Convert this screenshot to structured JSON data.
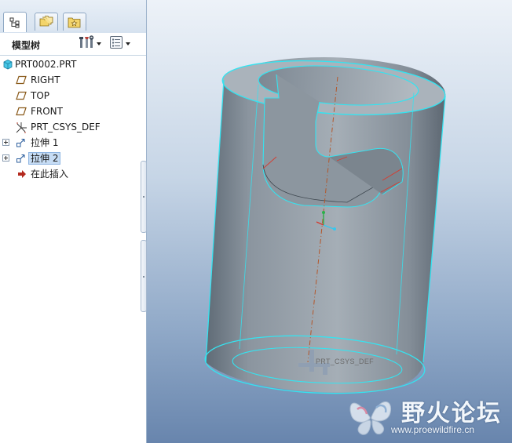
{
  "tabs": [
    {
      "icon": "model-tree-icon",
      "active": true
    },
    {
      "icon": "folder-browser-icon",
      "active": false
    },
    {
      "icon": "favorites-icon",
      "active": false
    }
  ],
  "panel": {
    "title": "模型树",
    "settings_icon": "tree-settings-icon",
    "show_icon": "tree-show-icon"
  },
  "tree": {
    "root": {
      "label": "PRT0002.PRT",
      "icon": "part-icon"
    },
    "items": [
      {
        "label": "RIGHT",
        "icon": "datum-plane-icon"
      },
      {
        "label": "TOP",
        "icon": "datum-plane-icon"
      },
      {
        "label": "FRONT",
        "icon": "datum-plane-icon"
      },
      {
        "label": "PRT_CSYS_DEF",
        "icon": "coordinate-system-icon"
      },
      {
        "label": "拉伸 1",
        "icon": "extrude-icon",
        "expandable": true
      },
      {
        "label": "拉伸 2",
        "icon": "extrude-icon",
        "expandable": true,
        "selected": true
      },
      {
        "label": "在此插入",
        "icon": "insert-here-arrow-icon"
      }
    ]
  },
  "viewport": {
    "csys_label": "PRT_CSYS_DEF",
    "colors": {
      "edge_highlight": "#35e3f0",
      "model_fill": "#9aa4ad",
      "datum_axis": "#b4572a"
    }
  },
  "watermark": {
    "title": "野火论坛",
    "url": "www.proewildfire.cn"
  }
}
